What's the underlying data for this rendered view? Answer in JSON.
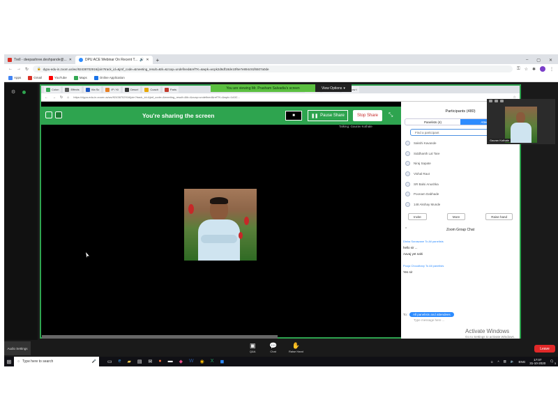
{
  "browser": {
    "tabs": [
      {
        "label": "Trell - deepashree.deshpande@...",
        "color": "#d93025"
      },
      {
        "label": "DPU ACE Webinar On Recent T...",
        "color": "#2d8cff",
        "active": true
      }
    ],
    "new_tab": "+",
    "window_controls": [
      "–",
      "▢",
      "✕"
    ],
    "url": "dypu-edu-in.zoom.us/wc/92438702916/join?track_id=&jmf_code=&meeting_result=&tk=&zcap=undefined&refTK=&wpk=wcpk2d6df18de10f6e7e894c91f6507a0de",
    "bookmarks": [
      {
        "label": "Apps",
        "color": "#4285f4"
      },
      {
        "label": "Gmail",
        "color": "#d93025"
      },
      {
        "label": "YouTube",
        "color": "#ff0000"
      },
      {
        "label": "Maps",
        "color": "#34a853"
      },
      {
        "label": "Online Application",
        "color": "#1a73e8"
      }
    ]
  },
  "shared_screen": {
    "inner_tabs": [
      "Colon",
      "Effects",
      "Vta Sc",
      "IP / Ki",
      "Descri",
      "Coach",
      "Paris",
      "LNG",
      "How s",
      "How t"
    ],
    "viewing_banner": "You are viewing Mr. Prasham Salvadia's screen",
    "view_options": "View Options",
    "inner_url": "https://dypu-edu-in.zoom.us/wc/92438702916/join?track_id=&jmf_code=&meeting_result=&tk=&zcap=undefined&refTK=&wpk=1A3C..."
  },
  "share_bar": {
    "status": "You're sharing the screen",
    "pause": "Pause Share",
    "stop": "Stop Share"
  },
  "talking": "Talking: Gaurav Kothale",
  "participants": {
    "title": "Participants (480)",
    "tab_panelists": "Panelists (4)",
    "tab_attendees": "Attendees",
    "search_placeholder": "Find a participant",
    "list": [
      "Sakshi Kavande",
      "Siddhanth Lal Tare",
      "Niraj Sapate",
      "Vishal Raut",
      "SR Balsi Anushka",
      "Poonam Dabhade",
      "148 Akshay Munde"
    ],
    "buttons": {
      "invite": "Invite",
      "more": "More",
      "raise_hand": "Raise hand"
    }
  },
  "chat": {
    "title": "Zoom Group Chat",
    "messages": [
      {
        "sender": "Disha Sonawane To All panelists",
        "lines": [
          "hello sir ...",
          "Aavaj yet nahi"
        ]
      },
      {
        "sender": "Pooja Choudhary To All panelists",
        "lines": [
          "Yes sir"
        ]
      }
    ],
    "to_label": "To:",
    "to_target": "All panelists and attendees",
    "placeholder": "Type message here ..."
  },
  "video_thumb": {
    "name": "Gaurav Kothale"
  },
  "watermark": {
    "line1": "Activate Windows",
    "line2": "Go to Settings to activate Windows."
  },
  "zoom_toolbar": {
    "audio_settings": "Audio Settings",
    "qa": "Q&A",
    "chat": "Chat",
    "raise_hand": "Raise Hand",
    "leave": "Leave"
  },
  "taskbar": {
    "search_placeholder": "Type here to search",
    "time": "17:07",
    "date": "31-10-2020",
    "notification_count": "3"
  },
  "colors": {
    "zoom_green": "#2ea44f",
    "zoom_blue": "#2d8cff",
    "leave_red": "#e02828"
  }
}
